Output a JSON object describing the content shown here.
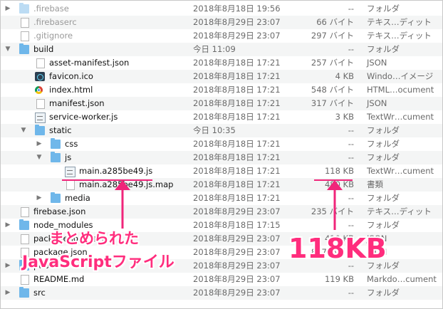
{
  "files": [
    {
      "name": ".firebase",
      "date": "2018年8月18日 19:56",
      "size": "--",
      "kind": "フォルダ",
      "depth": 0,
      "disclosure": "closed",
      "icon": "folder-light-icon",
      "dim": true
    },
    {
      "name": ".firebaserc",
      "date": "2018年8月29日 23:07",
      "size": "66 バイト",
      "kind": "テキス…ディット",
      "depth": 0,
      "disclosure": "",
      "icon": "document-icon",
      "dim": true
    },
    {
      "name": ".gitignore",
      "date": "2018年8月29日 23:07",
      "size": "297 バイト",
      "kind": "テキス…ディット",
      "depth": 0,
      "disclosure": "",
      "icon": "document-icon",
      "dim": true
    },
    {
      "name": "build",
      "date": "今日 11:09",
      "size": "--",
      "kind": "フォルダ",
      "depth": 0,
      "disclosure": "open",
      "icon": "folder-icon"
    },
    {
      "name": "asset-manifest.json",
      "date": "2018年8月18日 17:21",
      "size": "257 バイト",
      "kind": "JSON",
      "depth": 1,
      "disclosure": "",
      "icon": "document-icon"
    },
    {
      "name": "favicon.ico",
      "date": "2018年8月18日 17:21",
      "size": "4 KB",
      "kind": "Windo…イメージ",
      "depth": 1,
      "disclosure": "",
      "icon": "favicon-icon"
    },
    {
      "name": "index.html",
      "date": "2018年8月18日 17:21",
      "size": "548 バイト",
      "kind": "HTML…ocument",
      "depth": 1,
      "disclosure": "",
      "icon": "chrome-icon"
    },
    {
      "name": "manifest.json",
      "date": "2018年8月18日 17:21",
      "size": "317 バイト",
      "kind": "JSON",
      "depth": 1,
      "disclosure": "",
      "icon": "document-icon"
    },
    {
      "name": "service-worker.js",
      "date": "2018年8月18日 17:21",
      "size": "3 KB",
      "kind": "TextWr…cument",
      "depth": 1,
      "disclosure": "",
      "icon": "script-icon"
    },
    {
      "name": "static",
      "date": "今日 10:35",
      "size": "--",
      "kind": "フォルダ",
      "depth": 1,
      "disclosure": "open",
      "icon": "folder-icon"
    },
    {
      "name": "css",
      "date": "2018年8月18日 17:21",
      "size": "--",
      "kind": "フォルダ",
      "depth": 2,
      "disclosure": "closed",
      "icon": "folder-icon"
    },
    {
      "name": "js",
      "date": "2018年8月18日 17:21",
      "size": "--",
      "kind": "フォルダ",
      "depth": 2,
      "disclosure": "open",
      "icon": "folder-icon"
    },
    {
      "name": "main.a285be49.js",
      "date": "2018年8月18日 17:21",
      "size": "118 KB",
      "kind": "TextWr…cument",
      "depth": 3,
      "disclosure": "",
      "icon": "script-icon"
    },
    {
      "name": "main.a285be49.js.map",
      "date": "2018年8月18日 17:21",
      "size": "480 KB",
      "kind": "書類",
      "depth": 3,
      "disclosure": "",
      "icon": "document-icon"
    },
    {
      "name": "media",
      "date": "2018年8月18日 17:21",
      "size": "--",
      "kind": "フォルダ",
      "depth": 2,
      "disclosure": "closed",
      "icon": "folder-icon"
    },
    {
      "name": "firebase.json",
      "date": "2018年8月29日 23:07",
      "size": "235 バイト",
      "kind": "テキス…ディット",
      "depth": 0,
      "disclosure": "",
      "icon": "document-icon"
    },
    {
      "name": "node_modules",
      "date": "2018年8月18日 17:15",
      "size": "--",
      "kind": "フォルダ",
      "depth": 0,
      "disclosure": "closed",
      "icon": "folder-icon"
    },
    {
      "name": "package-lock.json",
      "date": "2018年8月29日 23:07",
      "size": "410 KB",
      "kind": "JSON",
      "depth": 0,
      "disclosure": "",
      "icon": "document-icon"
    },
    {
      "name": "package.json",
      "date": "2018年8月29日 23:07",
      "size": "857 バイト",
      "kind": "JSON",
      "depth": 0,
      "disclosure": "",
      "icon": "document-icon"
    },
    {
      "name": "public",
      "date": "2018年8月29日 23:07",
      "size": "--",
      "kind": "フォルダ",
      "depth": 0,
      "disclosure": "closed",
      "icon": "folder-icon"
    },
    {
      "name": "README.md",
      "date": "2018年8月29日 23:07",
      "size": "119 KB",
      "kind": "Markdo…cument",
      "depth": 0,
      "disclosure": "",
      "icon": "document-icon"
    },
    {
      "name": "src",
      "date": "2018年8月29日 23:07",
      "size": "--",
      "kind": "フォルダ",
      "depth": 0,
      "disclosure": "closed",
      "icon": "folder-icon"
    }
  ],
  "annotations": {
    "left_label_line1": "まとめられた",
    "left_label_line2": "JavaScriptファイル",
    "right_label": "118KB",
    "color": "#ff2d7d"
  }
}
